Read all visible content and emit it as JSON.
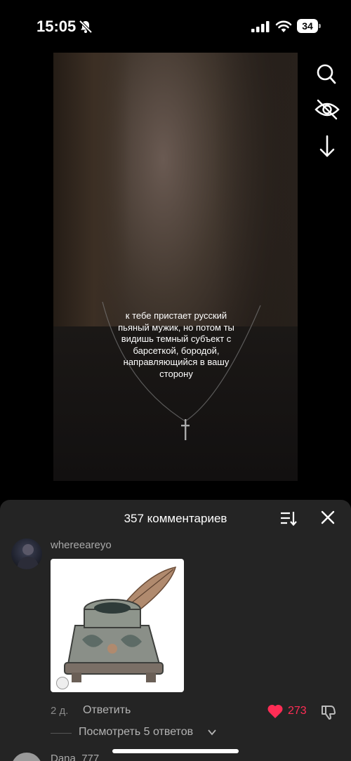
{
  "status_bar": {
    "time": "15:05",
    "battery": "34",
    "icons": [
      "bell-slash-icon",
      "cellular-signal-icon",
      "wifi-icon",
      "battery-icon"
    ]
  },
  "video": {
    "caption": "к тебе пристает русский пьяный мужик, но потом ты видишь темный субъект с барсеткой, бородой, направляющийся в вашу сторону"
  },
  "side_actions": {
    "icons": [
      "search-icon",
      "eye-slash-icon",
      "download-arrow-icon"
    ]
  },
  "comments_sheet": {
    "title": "357 комментариев",
    "icons": [
      "sort-icon",
      "close-icon"
    ],
    "comments": [
      {
        "username": "whereeareyo",
        "image_icon": "inkwell-quill-image",
        "age": "2 д.",
        "reply_label": "Ответить",
        "likes": "273",
        "view_replies": "Посмотреть 5 ответов"
      },
      {
        "username": "Dana_777"
      }
    ]
  },
  "colors": {
    "accent_like": "#ff2d55",
    "sheet_bg": "#242424",
    "secondary_text": "#a9a9a9"
  }
}
